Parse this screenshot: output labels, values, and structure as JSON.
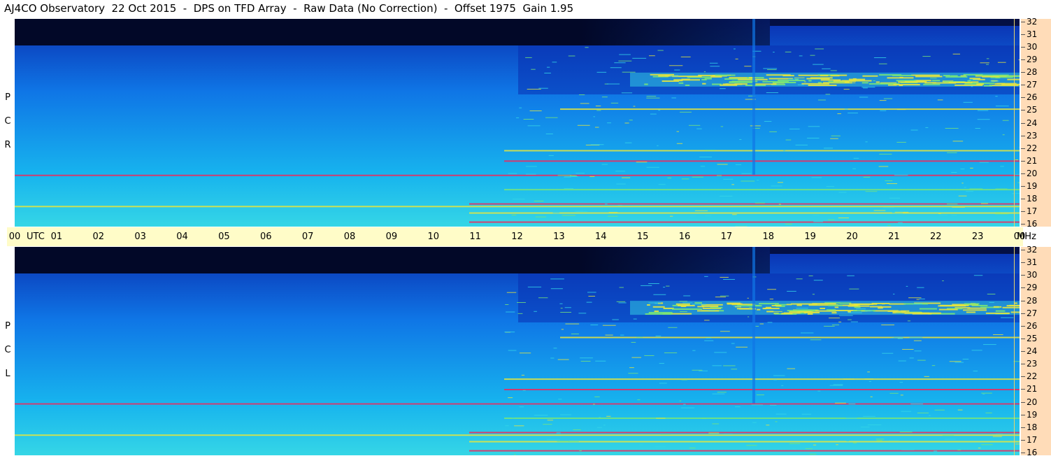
{
  "header": {
    "title": "AJ4CO Observatory  22 Oct 2015  -  DPS on TFD Array  -  Raw Data (No Correction)  -  Offset 1975  Gain 1.95"
  },
  "chart_data": {
    "type": "heatmap",
    "title": "AJ4CO Observatory  22 Oct 2015  -  DPS on TFD Array  -  Raw Data (No Correction)  -  Offset 1975  Gain 1.95",
    "panels": [
      {
        "name": "R C P",
        "letters": [
          "R",
          "C",
          "P"
        ]
      },
      {
        "name": "L C P",
        "letters": [
          "L",
          "C",
          "P"
        ]
      }
    ],
    "x_axis": {
      "label": "UTC",
      "ticks": [
        "00",
        "01",
        "02",
        "03",
        "04",
        "05",
        "06",
        "07",
        "08",
        "09",
        "10",
        "11",
        "12",
        "13",
        "14",
        "15",
        "16",
        "17",
        "18",
        "19",
        "20",
        "21",
        "22",
        "23",
        "00"
      ],
      "range": [
        0,
        24
      ]
    },
    "y_axis": {
      "label": "MHz",
      "ticks": [
        "32",
        "31",
        "30",
        "29",
        "28",
        "27",
        "26",
        "25",
        "24",
        "23",
        "22",
        "21",
        "20",
        "19",
        "18",
        "17",
        "16"
      ],
      "range": [
        16,
        32
      ]
    },
    "colors": {
      "dark": "#020828",
      "deep": "#0a2fb0",
      "mid": "#0f76e6",
      "cyan": "#17b4ee",
      "light": "#35d6e6",
      "yellow": "#e6e63c",
      "red": "#f0285a",
      "green": "#78e678"
    }
  }
}
